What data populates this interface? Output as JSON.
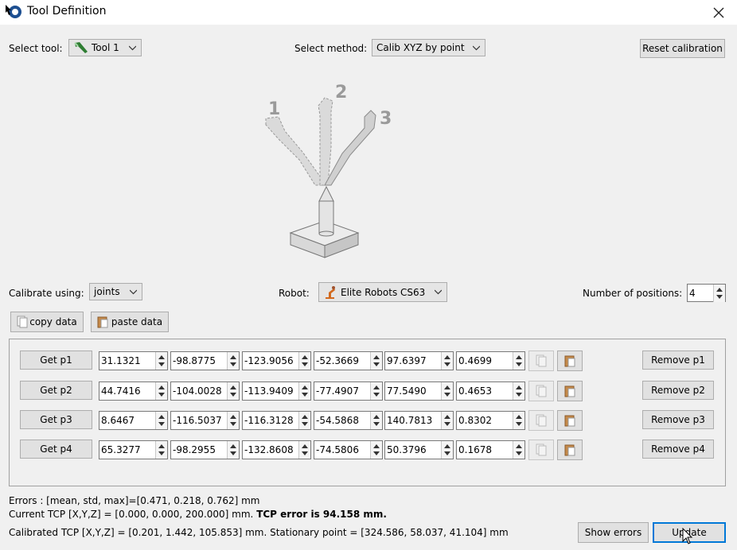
{
  "window": {
    "title": "Tool Definition"
  },
  "top": {
    "select_tool_label": "Select tool:",
    "tool_value": "Tool 1",
    "select_method_label": "Select method:",
    "method_value": "Calib XYZ by point",
    "reset_label": "Reset calibration"
  },
  "illustration": {
    "labels": [
      "1",
      "2",
      "3"
    ]
  },
  "mid": {
    "calibrate_label": "Calibrate using:",
    "calibrate_value": "joints",
    "robot_label": "Robot:",
    "robot_value": "Elite Robots CS63",
    "positions_label": "Number of positions:",
    "positions_value": "4",
    "copy_label": "copy data",
    "paste_label": "paste data"
  },
  "points": [
    {
      "get": "Get p1",
      "remove": "Remove p1",
      "values": [
        "31.1321",
        "-98.8775",
        "-123.9056",
        "-52.3669",
        "97.6397",
        "0.4699"
      ]
    },
    {
      "get": "Get p2",
      "remove": "Remove p2",
      "values": [
        "44.7416",
        "-104.0028",
        "-113.9409",
        "-77.4907",
        "77.5490",
        "0.4653"
      ]
    },
    {
      "get": "Get p3",
      "remove": "Remove p3",
      "values": [
        "8.6467",
        "-116.5037",
        "-116.3128",
        "-54.5868",
        "140.7813",
        "0.8302"
      ]
    },
    {
      "get": "Get p4",
      "remove": "Remove p4",
      "values": [
        "65.3277",
        "-98.2955",
        "-132.8608",
        "-74.5806",
        "50.3796",
        "0.1678"
      ]
    }
  ],
  "status": {
    "errors": "Errors : [mean, std, max]=[0.471, 0.218, 0.762] mm",
    "current_tcp": "Current TCP [X,Y,Z] = [0.000, 0.000, 200.000] mm.",
    "tcp_error": "TCP error is 94.158 mm.",
    "calibrated_tcp": "Calibrated TCP [X,Y,Z] = [0.201, 1.442, 105.853] mm. Stationary point = [324.586, 58.037, 41.104] mm"
  },
  "bottom": {
    "show_errors_label": "Show errors",
    "update_label": "Update"
  },
  "colors": {
    "accent": "#0078d7",
    "background": "#f0f0f0",
    "robot_icon": "#d2691e",
    "tool_icon": "#2e7d32"
  }
}
